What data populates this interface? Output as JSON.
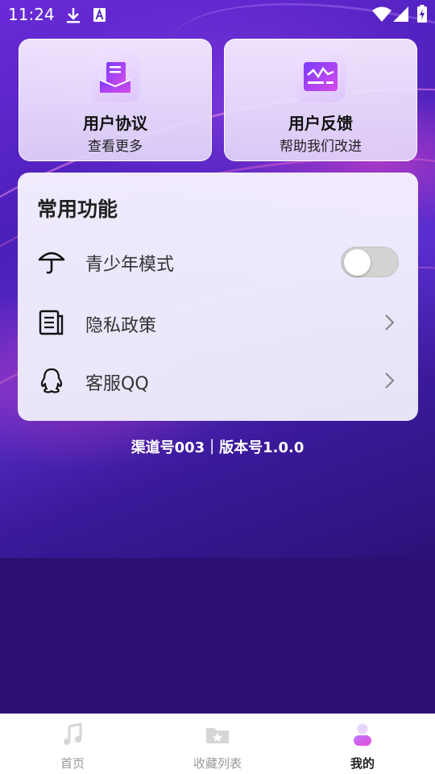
{
  "status_bar": {
    "time": "11:24",
    "icons": [
      "download-icon",
      "notification-a-icon",
      "wifi-icon",
      "signal-icon",
      "battery-charging-icon"
    ]
  },
  "cards": [
    {
      "title": "用户协议",
      "subtitle": "查看更多",
      "icon": "agreement-icon"
    },
    {
      "title": "用户反馈",
      "subtitle": "帮助我们改进",
      "icon": "feedback-icon"
    }
  ],
  "common_functions": {
    "title": "常用功能",
    "items": [
      {
        "label": "青少年模式",
        "icon": "umbrella-icon",
        "control": "toggle",
        "toggle_on": false
      },
      {
        "label": "隐私政策",
        "icon": "document-icon",
        "control": "chevron"
      },
      {
        "label": "客服QQ",
        "icon": "qq-icon",
        "control": "chevron"
      }
    ]
  },
  "version_text": "渠道号003｜版本号1.0.0",
  "tabs": [
    {
      "label": "首页",
      "icon": "music-note-icon",
      "active": false
    },
    {
      "label": "收藏列表",
      "icon": "folder-star-icon",
      "active": false
    },
    {
      "label": "我的",
      "icon": "user-icon",
      "active": true
    }
  ],
  "colors": {
    "active_tab_gradient": [
      "#b978ff",
      "#e84bd6"
    ],
    "card_icon_gradient": [
      "#7a3cff",
      "#d84be8"
    ]
  }
}
